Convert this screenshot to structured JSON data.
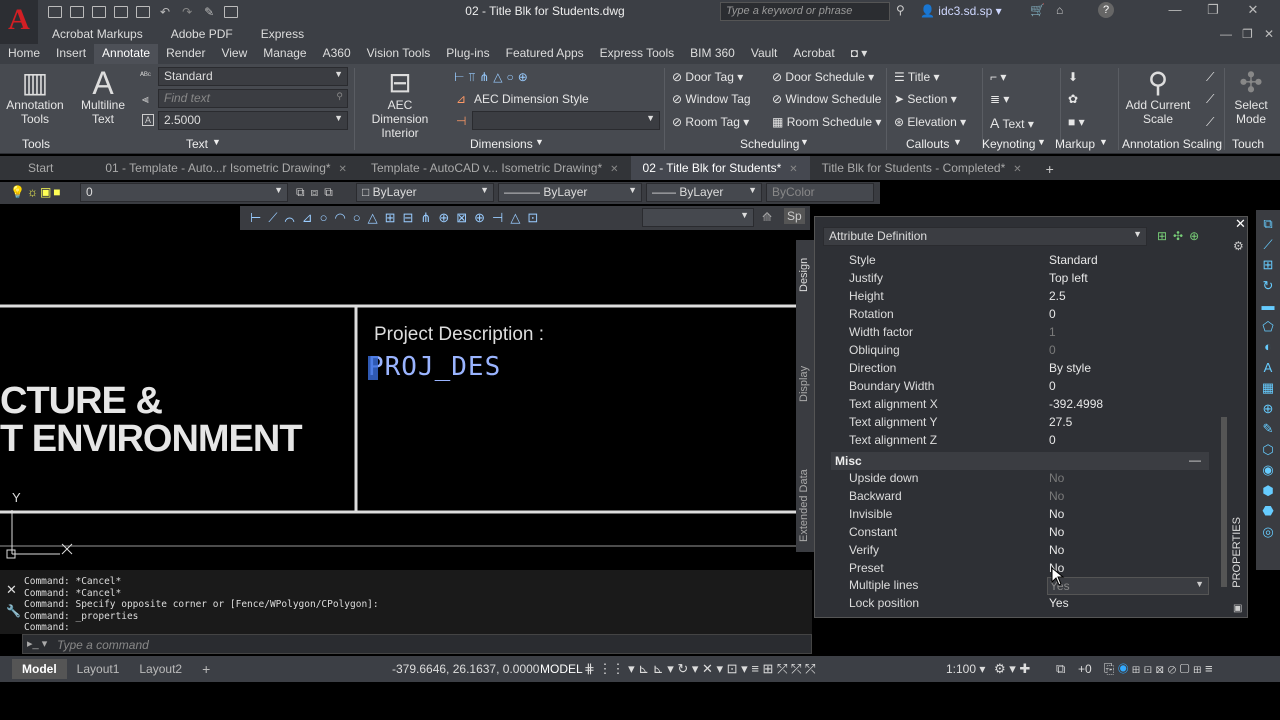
{
  "app": {
    "logo": "A",
    "doc_title": "02 - Title Blk for Students.dwg",
    "search_placeholder": "Type a keyword or phrase",
    "user": "idc3.sd.sp"
  },
  "menu2": [
    "Acrobat Markups",
    "Adobe PDF",
    "Express"
  ],
  "ribbon_tabs": [
    "Home",
    "Insert",
    "Annotate",
    "Render",
    "View",
    "Manage",
    "A360",
    "Vision Tools",
    "Plug-ins",
    "Featured Apps",
    "Express Tools",
    "BIM 360",
    "Vault",
    "Acrobat"
  ],
  "ribbon": {
    "annotation_tools": "Annotation Tools",
    "multiline_text": "Multiline Text",
    "text_style": "Standard",
    "find_text_placeholder": "Find text",
    "text_height": "2.5000",
    "aec_dim_interior": "AEC Dimension Interior",
    "aec_dim_style": "AEC Dimension Style",
    "door_tag": "Door Tag",
    "window_tag": "Window Tag",
    "room_tag": "Room Tag",
    "door_schedule": "Door Schedule",
    "window_schedule": "Window Schedule",
    "room_schedule": "Room Schedule",
    "title": "Title",
    "section": "Section",
    "elevation": "Elevation",
    "text_keynote": "Text",
    "add_scale": "Add Current Scale",
    "select_mode": "Select Mode",
    "panels": [
      "Tools",
      "Text",
      "Dimensions",
      "Scheduling",
      "Callouts",
      "Keynoting",
      "Markup",
      "Annotation Scaling",
      "Touch"
    ]
  },
  "doc_tabs": [
    {
      "label": "Start",
      "active": false
    },
    {
      "label": "01 - Template - Auto...r Isometric Drawing*",
      "active": false
    },
    {
      "label": "Template - AutoCAD v... Isometric Drawing*",
      "active": false
    },
    {
      "label": "02 - Title Blk for Students*",
      "active": true
    },
    {
      "label": "Title Blk for Students - Completed*",
      "active": false
    }
  ],
  "layer_bar": {
    "layer": "0",
    "color": "ByLayer",
    "linetype": "ByLayer",
    "lineweight": "ByLayer",
    "plotstyle": "ByColor"
  },
  "canvas": {
    "project_label": "Project Description :",
    "attr_tag": "PROJ_DES",
    "line1": "CTURE &",
    "line2": "T ENVIRONMENT",
    "y_axis": "Y",
    "x_axis": "X"
  },
  "props": {
    "selector": "Attribute Definition",
    "side_tabs": [
      "Design",
      "Display",
      "Extended Data"
    ],
    "rows": [
      {
        "label": "Style",
        "value": "Standard",
        "dim": false
      },
      {
        "label": "Justify",
        "value": "Top left",
        "dim": false
      },
      {
        "label": "Height",
        "value": "2.5",
        "dim": false
      },
      {
        "label": "Rotation",
        "value": "0",
        "dim": false
      },
      {
        "label": "Width factor",
        "value": "1",
        "dim": true
      },
      {
        "label": "Obliquing",
        "value": "0",
        "dim": true
      },
      {
        "label": "Direction",
        "value": "By style",
        "dim": false
      },
      {
        "label": "Boundary Width",
        "value": "0",
        "dim": false
      },
      {
        "label": "Text alignment X",
        "value": "-392.4998",
        "dim": false
      },
      {
        "label": "Text alignment Y",
        "value": "27.5",
        "dim": false
      },
      {
        "label": "Text alignment Z",
        "value": "0",
        "dim": false
      }
    ],
    "misc_header": "Misc",
    "misc_rows": [
      {
        "label": "Upside down",
        "value": "No",
        "dim": true
      },
      {
        "label": "Backward",
        "value": "No",
        "dim": true
      },
      {
        "label": "Invisible",
        "value": "No",
        "dim": false
      },
      {
        "label": "Constant",
        "value": "No",
        "dim": false
      },
      {
        "label": "Verify",
        "value": "No",
        "dim": false
      },
      {
        "label": "Preset",
        "value": "No",
        "dim": false
      },
      {
        "label": "Multiple lines",
        "value": "Yes",
        "dim": false
      },
      {
        "label": "Lock position",
        "value": "Yes",
        "dim": false
      }
    ],
    "palette_title": "PROPERTIES"
  },
  "command": {
    "history": [
      "Command: *Cancel*",
      "Command: *Cancel*",
      "Command: Specify opposite corner or [Fence/WPolygon/CPolygon]:",
      "Command: _properties",
      "Command:"
    ],
    "placeholder": "Type a command"
  },
  "status": {
    "layout_tabs": [
      "Model",
      "Layout1",
      "Layout2"
    ],
    "coords": "-379.6646, 26.1637, 0.0000",
    "model": "MODEL",
    "scale": "1:100",
    "plus": "+0"
  }
}
